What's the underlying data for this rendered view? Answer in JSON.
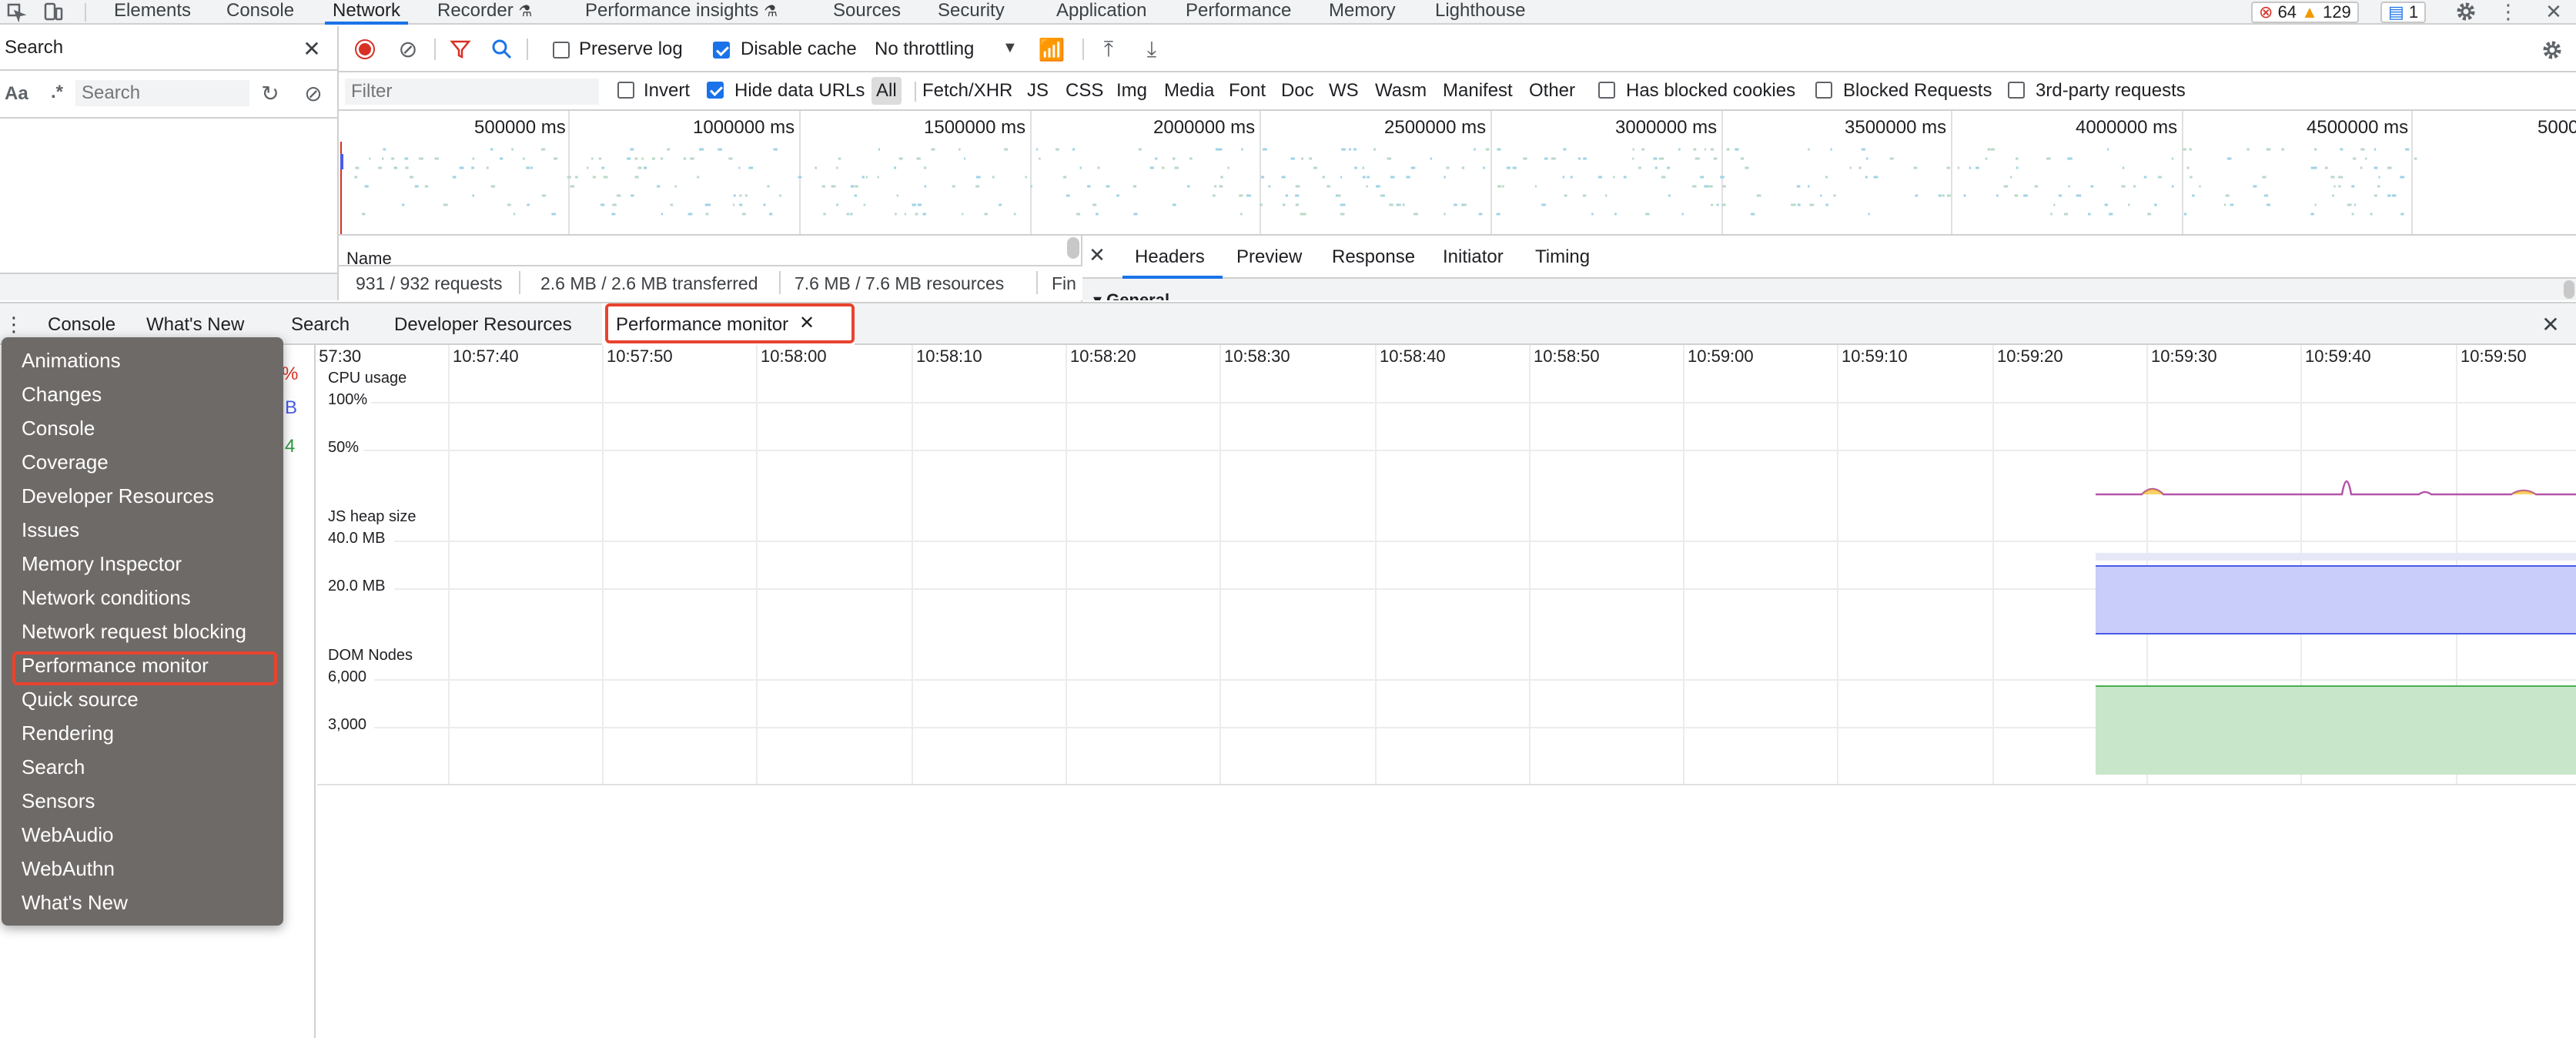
{
  "main_tabs": [
    "Elements",
    "Console",
    "Network",
    "Recorder",
    "Performance insights",
    "Sources",
    "Security",
    "Application",
    "Performance",
    "Memory",
    "Lighthouse"
  ],
  "active_main_tab": "Network",
  "issues": {
    "errors": "64",
    "warnings": "129",
    "info": "1"
  },
  "search_panel": {
    "title": "Search",
    "case_label": "Aa",
    "regex_label": ".*",
    "placeholder": "Search"
  },
  "network_toolbar": {
    "preserve_log": "Preserve log",
    "disable_cache": "Disable cache",
    "throttling": "No throttling"
  },
  "filter_bar": {
    "placeholder": "Filter",
    "invert": "Invert",
    "hide_data_urls": "Hide data URLs",
    "types": [
      "All",
      "Fetch/XHR",
      "JS",
      "CSS",
      "Img",
      "Media",
      "Font",
      "Doc",
      "WS",
      "Wasm",
      "Manifest",
      "Other"
    ],
    "has_blocked_cookies": "Has blocked cookies",
    "blocked_requests": "Blocked Requests",
    "third_party": "3rd-party requests"
  },
  "overview_ticks": [
    "500000 ms",
    "1000000 ms",
    "1500000 ms",
    "2000000 ms",
    "2500000 ms",
    "3000000 ms",
    "3500000 ms",
    "4000000 ms",
    "4500000 ms",
    "5000"
  ],
  "name_header": "Name",
  "status": {
    "requests": "931 / 932 requests",
    "transferred": "2.6 MB / 2.6 MB transferred",
    "resources": "7.6 MB / 7.6 MB resources",
    "finish": "Fin"
  },
  "detail_tabs": [
    "Headers",
    "Preview",
    "Response",
    "Initiator",
    "Timing"
  ],
  "detail_section": "General",
  "drawer_tabs": [
    "Console",
    "What's New",
    "Search",
    "Developer Resources",
    "Performance monitor"
  ],
  "active_drawer_tab": "Performance monitor",
  "time_labels": [
    ":57:30",
    "10:57:40",
    "10:57:50",
    "10:58:00",
    "10:58:10",
    "10:58:20",
    "10:58:30",
    "10:58:40",
    "10:58:50",
    "10:59:00",
    "10:59:10",
    "10:59:20",
    "10:59:30",
    "10:59:40",
    "10:59:50"
  ],
  "graphs": {
    "cpu": {
      "title": "CPU usage",
      "ticks": [
        "100%",
        "50%"
      ],
      "color": "#b554a8"
    },
    "heap": {
      "title": "JS heap size",
      "ticks": [
        "40.0 MB",
        "20.0 MB"
      ],
      "color": "#4a5ae8"
    },
    "dom": {
      "title": "DOM Nodes",
      "ticks": [
        "6,000",
        "3,000"
      ],
      "color": "#4caf50"
    }
  },
  "partial_metrics": [
    "%",
    "B",
    "4"
  ],
  "menu_items": [
    "Animations",
    "Changes",
    "Console",
    "Coverage",
    "Developer Resources",
    "Issues",
    "Memory Inspector",
    "Network conditions",
    "Network request blocking",
    "Performance monitor",
    "Quick source",
    "Rendering",
    "Search",
    "Sensors",
    "WebAudio",
    "WebAuthn",
    "What's New"
  ],
  "highlighted_menu_item": "Performance monitor"
}
